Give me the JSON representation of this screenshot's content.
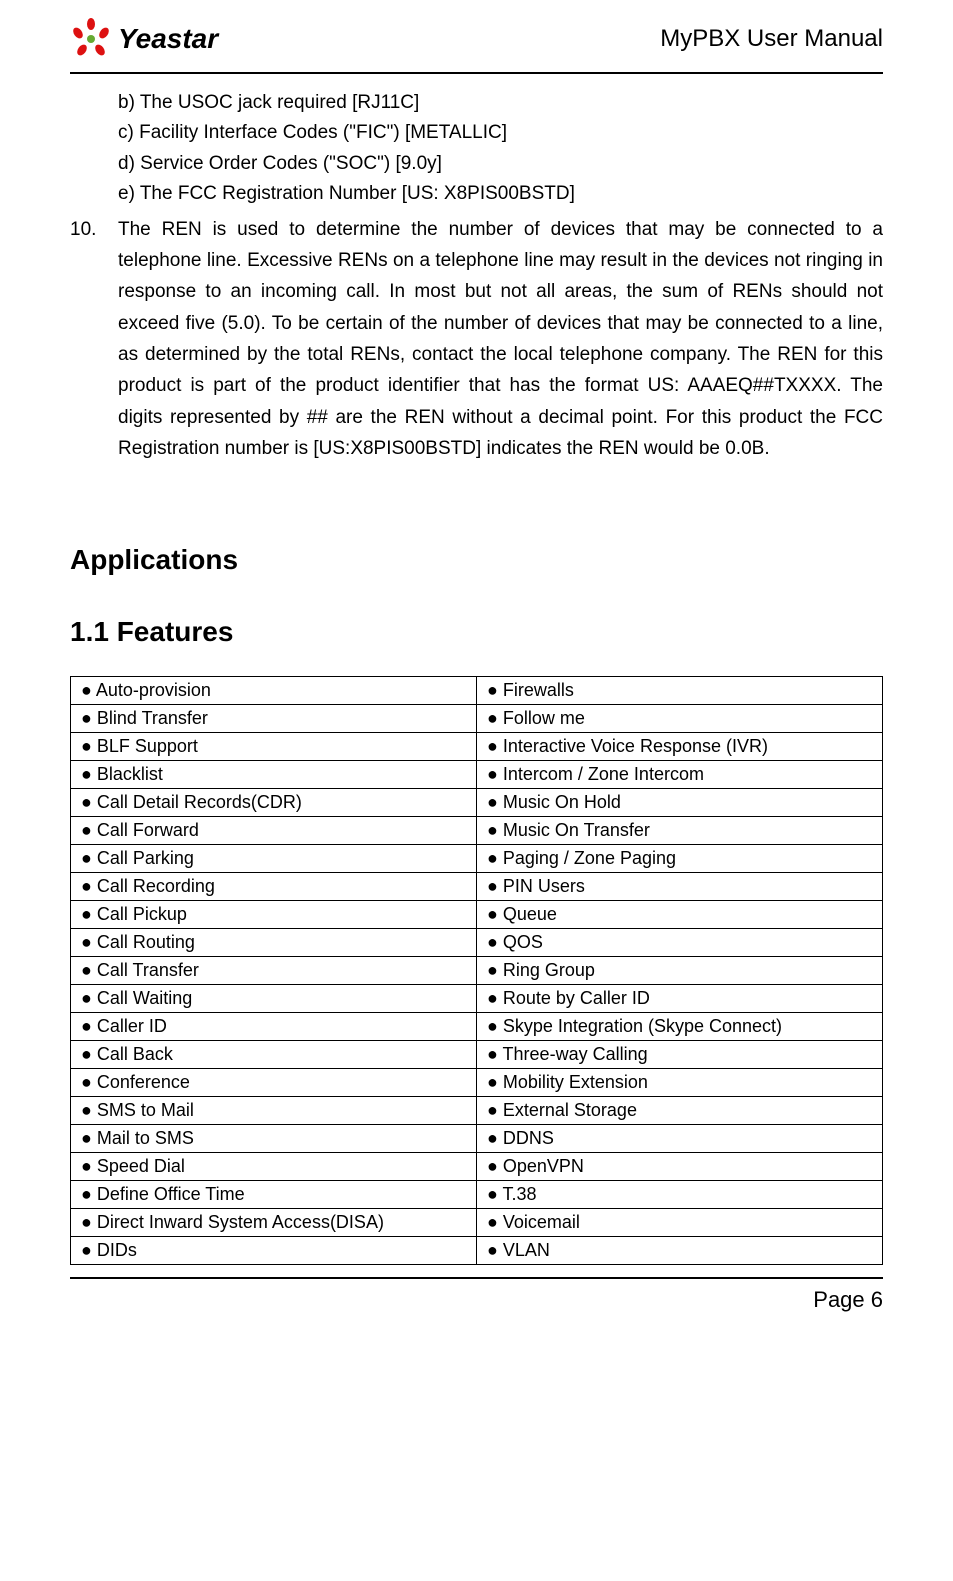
{
  "header": {
    "logo_text": "Yeastar",
    "doc_title": "MyPBX User Manual"
  },
  "sub_items": {
    "b": "b) The USOC jack required [RJ11C]",
    "c": "c) Facility Interface Codes (\"FIC\") [METALLIC]",
    "d": "d) Service Order Codes (\"SOC\") [9.0y]",
    "e": "e) The FCC Registration Number [US: X8PIS00BSTD]"
  },
  "item10": {
    "num": "10.",
    "text": "The REN is used to determine the number of devices that may be connected to a telephone line. Excessive RENs on a telephone line may result in the devices not ringing in response to an incoming call. In most but not all areas, the sum of RENs should not exceed five (5.0). To be certain of the number of devices that may be connected to a line, as determined by the total RENs, contact the local telephone company. The REN for this product is part of the product identifier that has the format US: AAAEQ##TXXXX. The digits represented by ## are the REN without a decimal point. For this product the FCC Registration number is [US:X8PIS00BSTD] indicates the REN would be 0.0B."
  },
  "headings": {
    "applications": "Applications",
    "features": "1.1 Features"
  },
  "features_table": {
    "rows": [
      {
        "left": "● Auto-provision",
        "right": "  ● Firewalls"
      },
      {
        "left": "● Blind Transfer",
        "right": "● Follow me"
      },
      {
        "left": "● BLF Support",
        "right": "● Interactive Voice Response (IVR)"
      },
      {
        "left": "● Blacklist",
        "right": "● Intercom / Zone Intercom"
      },
      {
        "left": "● Call Detail Records(CDR)",
        "right": "● Music On Hold"
      },
      {
        "left": "● Call Forward",
        "right": "● Music On Transfer"
      },
      {
        "left": "● Call Parking",
        "right": "● Paging / Zone Paging"
      },
      {
        "left": "● Call Recording",
        "right": "● PIN Users"
      },
      {
        "left": "● Call Pickup",
        "right": "● Queue"
      },
      {
        "left": "● Call Routing",
        "right": "● QOS"
      },
      {
        "left": "● Call Transfer",
        "right": "● Ring Group"
      },
      {
        "left": "● Call Waiting",
        "right": "● Route by Caller ID"
      },
      {
        "left": "● Caller ID",
        "right": "● Skype Integration (Skype Connect)"
      },
      {
        "left": "● Call Back",
        "right": "● Three-way Calling"
      },
      {
        "left": "● Conference",
        "right": "● Mobility Extension"
      },
      {
        "left": "● SMS to Mail",
        "right": "● External Storage"
      },
      {
        "left": "● Mail to SMS",
        "right": "● DDNS"
      },
      {
        "left": "● Speed Dial",
        "right": "● OpenVPN"
      },
      {
        "left": "● Define Office Time",
        "right": "● T.38"
      },
      {
        "left": "● Direct Inward System Access(DISA)",
        "right": "● Voicemail"
      },
      {
        "left": "● DIDs",
        "right": "● VLAN"
      }
    ]
  },
  "footer": {
    "page": "Page 6"
  }
}
